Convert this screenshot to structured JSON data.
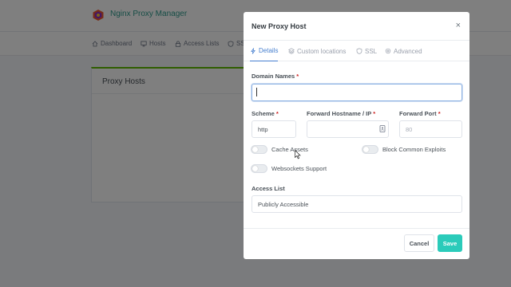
{
  "app": {
    "title": "Nginx Proxy Manager",
    "nav": [
      {
        "label": "Dashboard",
        "icon": "home-icon"
      },
      {
        "label": "Hosts",
        "icon": "monitor-icon"
      },
      {
        "label": "Access Lists",
        "icon": "lock-icon"
      },
      {
        "label": "SSL",
        "icon": "shield-icon"
      }
    ],
    "card_title": "Proxy Hosts"
  },
  "modal": {
    "title": "New Proxy Host",
    "close": "×",
    "tabs": [
      {
        "label": "Details",
        "icon": "bolt-icon",
        "active": true
      },
      {
        "label": "Custom locations",
        "icon": "layers-icon",
        "active": false
      },
      {
        "label": "SSL",
        "icon": "shield-icon",
        "active": false
      },
      {
        "label": "Advanced",
        "icon": "gear-icon",
        "active": false
      }
    ],
    "fields": {
      "domain_names": {
        "label": "Domain Names",
        "required": "*",
        "value": ""
      },
      "scheme": {
        "label": "Scheme",
        "required": "*",
        "value": "http"
      },
      "forward_host": {
        "label": "Forward Hostname / IP",
        "required": "*",
        "value": ""
      },
      "forward_port": {
        "label": "Forward Port",
        "required": "*",
        "placeholder": "80",
        "value": ""
      }
    },
    "toggles": {
      "cache_assets": {
        "label": "Cache Assets",
        "on": false
      },
      "block_exploits": {
        "label": "Block Common Exploits",
        "on": false
      },
      "websockets": {
        "label": "Websockets Support",
        "on": false
      }
    },
    "access_list": {
      "label": "Access List",
      "value": "Publicly Accessible"
    },
    "buttons": {
      "cancel": "Cancel",
      "save": "Save"
    }
  },
  "colors": {
    "accent": "#467fcf",
    "brand": "#2d9a8c",
    "save": "#2bcbba",
    "card_top": "#5eba00",
    "required": "#cd201f"
  }
}
